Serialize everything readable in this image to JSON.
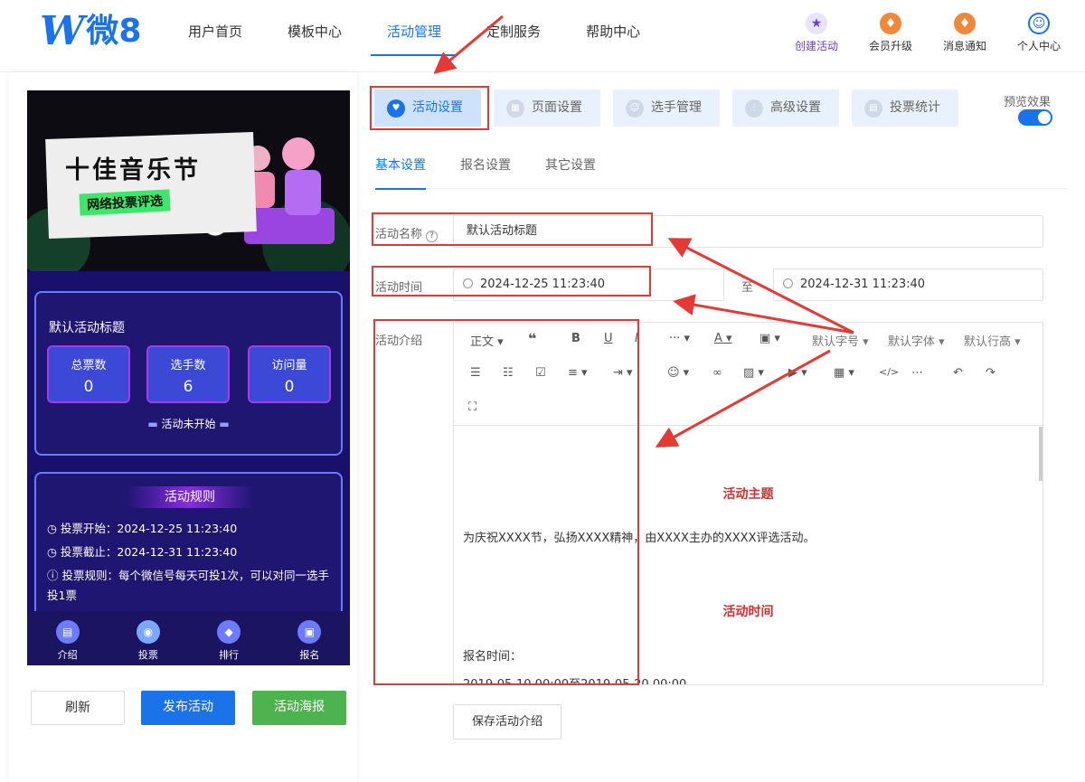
{
  "logo": {
    "mark": "W",
    "text": "微8"
  },
  "nav": [
    "用户首页",
    "模板中心",
    "活动管理",
    "定制服务",
    "帮助中心"
  ],
  "tools": [
    {
      "label": "创建活动",
      "icon": "star-icon",
      "color": "#6a3de8"
    },
    {
      "label": "会员升级",
      "icon": "crown-icon",
      "color": "#f0883a"
    },
    {
      "label": "消息通知",
      "icon": "bell-icon",
      "color": "#f0883a"
    },
    {
      "label": "个人中心",
      "icon": "user-icon",
      "color": "#1a73e8"
    }
  ],
  "phone": {
    "banner_title": "十佳音乐节",
    "banner_sub": "网络投票评选",
    "title": "默认活动标题",
    "stats": [
      {
        "label": "总票数",
        "value": "0"
      },
      {
        "label": "选手数",
        "value": "6"
      },
      {
        "label": "访问量",
        "value": "0"
      }
    ],
    "status": "活动未开始",
    "rules_title": "活动规则",
    "rules": [
      "投票开始：2024-12-25 11:23:40",
      "投票截止：2024-12-31 11:23:40",
      "投票规则：每个微信号每天可投1次，可以对同一选手投1票"
    ],
    "nav": [
      "介绍",
      "投票",
      "排行",
      "报名"
    ]
  },
  "buttons": {
    "refresh": "刷新",
    "publish": "发布活动",
    "poster": "活动海报",
    "save": "保存活动介绍"
  },
  "tabs": [
    "活动设置",
    "页面设置",
    "选手管理",
    "高级设置",
    "投票统计"
  ],
  "preview_label": "预览效果",
  "subtabs": [
    "基本设置",
    "报名设置",
    "其它设置"
  ],
  "form": {
    "name_label": "活动名称",
    "name_value": "默认活动标题",
    "time_label": "活动时间",
    "start_time": "2024-12-25 11:23:40",
    "to_label": "至",
    "end_time": "2024-12-31 11:23:40",
    "intro_label": "活动介绍"
  },
  "editor": {
    "toolbar": {
      "paragraph": "正文",
      "size": "默认字号",
      "font": "默认字体",
      "line_height": "默认行高"
    },
    "heading1": "活动主题",
    "paragraph1": "为庆祝XXXX节，弘扬XXXX精神，由XXXX主办的XXXX评选活动。",
    "heading2": "活动时间",
    "signup_label": "报名时间：",
    "signup_time": "2019-05-10 00:00至2019-05-20 00:00"
  },
  "colors": {
    "accent": "#1a73e8",
    "publish": "#1a73e8",
    "poster": "#4cb34f",
    "annotation": "#e53935",
    "heading": "#d32f2f"
  }
}
